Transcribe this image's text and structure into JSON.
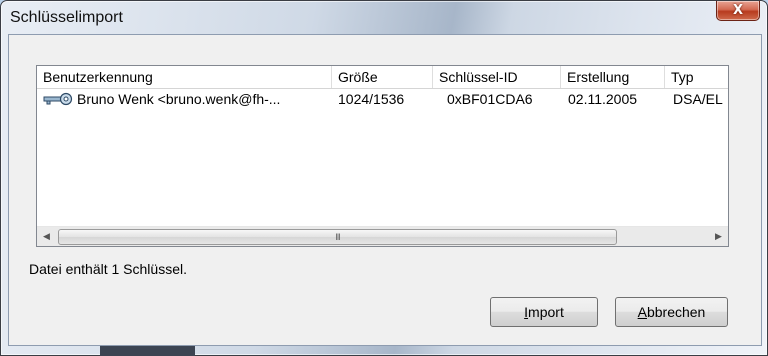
{
  "window": {
    "title": "Schlüsselimport"
  },
  "list": {
    "columns": [
      "Benutzerkennung",
      "Größe",
      "Schlüssel-ID",
      "Erstellung",
      "Typ"
    ],
    "rows": [
      {
        "user": "Bruno Wenk <bruno.wenk@fh-...",
        "size": "1024/1536",
        "key_id": "0xBF01CDA6",
        "created": "02.11.2005",
        "type": "DSA/EL",
        "icon": "key-icon"
      }
    ]
  },
  "status": "Datei enthält 1 Schlüssel.",
  "buttons": {
    "import_prefix": "",
    "import_underline": "I",
    "import_rest": "mport",
    "cancel_prefix": "",
    "cancel_underline": "A",
    "cancel_rest": "bbrechen"
  },
  "scrollbar": {
    "thumb_grip": "III"
  },
  "close_glyph": "X"
}
